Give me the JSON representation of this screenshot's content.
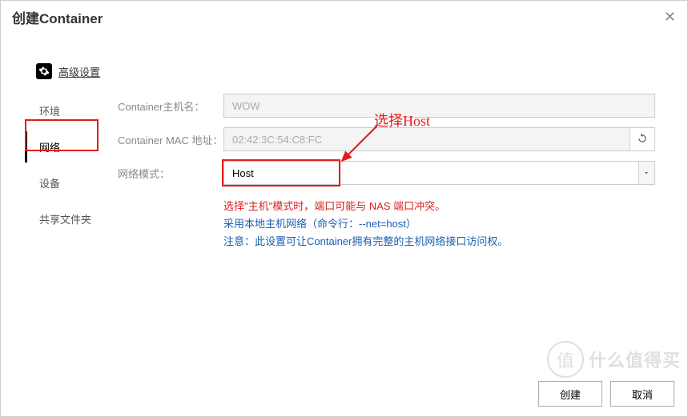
{
  "title": "创建Container",
  "advanced_label": "高级设置",
  "sidebar": {
    "items": [
      {
        "label": "环境"
      },
      {
        "label": "网络"
      },
      {
        "label": "设备"
      },
      {
        "label": "共享文件夹"
      }
    ]
  },
  "form": {
    "hostname_label": "Container主机名：",
    "hostname_value": "WOW",
    "mac_label": "Container MAC 地址：",
    "mac_value": "02:42:3C:54:C8:FC",
    "netmode_label": "网络模式：",
    "netmode_value": "Host"
  },
  "notes": {
    "line1": "选择\"主机\"模式时，端口可能与 NAS 端口冲突。",
    "line2": "采用本地主机网络（命令行：--net=host）",
    "line3": "注意：此设置可让Container拥有完整的主机网络接口访问权。"
  },
  "footer": {
    "create": "创建",
    "cancel": "取消"
  },
  "annotation": {
    "label": "选择Host"
  },
  "watermark": {
    "icon": "值",
    "text": "什么值得买"
  }
}
